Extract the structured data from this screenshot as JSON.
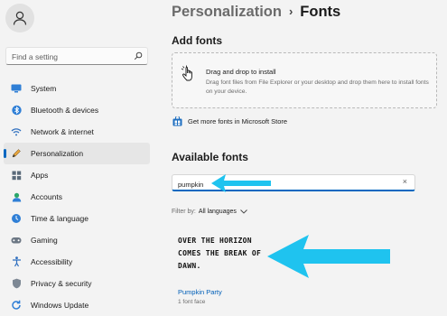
{
  "sidebar": {
    "search_placeholder": "Find a setting",
    "items": [
      {
        "label": "System",
        "icon": "monitor-icon"
      },
      {
        "label": "Bluetooth & devices",
        "icon": "bluetooth-icon"
      },
      {
        "label": "Network & internet",
        "icon": "wifi-icon"
      },
      {
        "label": "Personalization",
        "icon": "pen-icon",
        "active": true
      },
      {
        "label": "Apps",
        "icon": "apps-icon"
      },
      {
        "label": "Accounts",
        "icon": "account-icon"
      },
      {
        "label": "Time & language",
        "icon": "globe-clock-icon"
      },
      {
        "label": "Gaming",
        "icon": "gamepad-icon"
      },
      {
        "label": "Accessibility",
        "icon": "accessibility-icon"
      },
      {
        "label": "Privacy & security",
        "icon": "shield-icon"
      },
      {
        "label": "Windows Update",
        "icon": "update-icon"
      }
    ]
  },
  "header": {
    "breadcrumb_parent": "Personalization",
    "breadcrumb_separator": "›",
    "title": "Fonts"
  },
  "add_fonts": {
    "title": "Add fonts",
    "dropzone_title": "Drag and drop to install",
    "dropzone_desc": "Drag font files from File Explorer or your desktop and drop them here to install fonts on your device.",
    "store_link": "Get more fonts in Microsoft Store"
  },
  "available": {
    "title": "Available fonts",
    "search_value": "pumpkin",
    "clear_glyph": "×",
    "filter_label": "Filter by:",
    "filter_value": "All languages",
    "fonts": [
      {
        "preview_text": "Over the horizon comes the break of dawn.",
        "name": "Pumpkin Party",
        "faces": "1 font face"
      }
    ]
  },
  "colors": {
    "accent": "#0067c0",
    "link": "#005fb8",
    "annotation_arrow": "#1fc3ef",
    "background": "#f3f3f3"
  }
}
